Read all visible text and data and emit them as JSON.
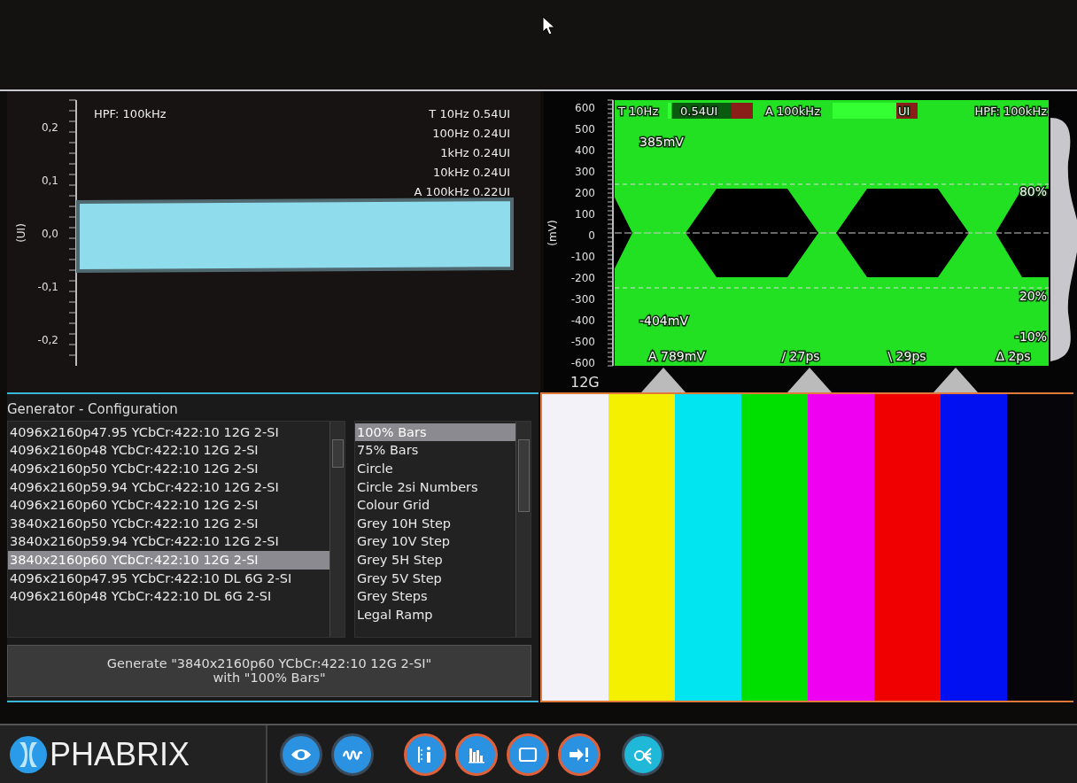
{
  "jitter_plot": {
    "y_axis_label": "(UI)",
    "y_ticks": [
      "0,2",
      "0,1",
      "0,0",
      "-0,1",
      "-0,2"
    ],
    "filter": "HPF: 100kHz",
    "readings": [
      "T 10Hz 0.54UI",
      "100Hz 0.24UI",
      "1kHz 0.24UI",
      "10kHz 0.24UI",
      "A 100kHz 0.22UI"
    ]
  },
  "eye_diagram": {
    "y_axis_label": "(mV)",
    "y_ticks": [
      "600",
      "500",
      "400",
      "300",
      "200",
      "100",
      "0",
      "-100",
      "-200",
      "-300",
      "-400",
      "-500",
      "-600"
    ],
    "rate": "12G",
    "filter": "HPF: 100kHz",
    "meters": [
      {
        "label": "T 10Hz",
        "value": "0.54UI",
        "level": 0.05
      },
      {
        "label": "A 100kHz",
        "value": "UI",
        "level": 0.85
      }
    ],
    "high_marker": "385mV",
    "low_marker": "-404mV",
    "thresholds": [
      "80%",
      "20%",
      "-10%"
    ],
    "measurements": [
      "A 789mV",
      "/ 27ps",
      "\\ 29ps",
      "Δ 2ps"
    ]
  },
  "generator": {
    "title": "Generator - Configuration",
    "formats": [
      {
        "label": "4096x2160p47.95 YCbCr:422:10 12G 2-SI",
        "selected": false
      },
      {
        "label": "4096x2160p48 YCbCr:422:10 12G 2-SI",
        "selected": false
      },
      {
        "label": "4096x2160p50 YCbCr:422:10 12G 2-SI",
        "selected": false
      },
      {
        "label": "4096x2160p59.94 YCbCr:422:10 12G 2-SI",
        "selected": false
      },
      {
        "label": "4096x2160p60 YCbCr:422:10 12G 2-SI",
        "selected": false
      },
      {
        "label": "3840x2160p50 YCbCr:422:10 12G 2-SI",
        "selected": false
      },
      {
        "label": "3840x2160p59.94 YCbCr:422:10 12G 2-SI",
        "selected": false
      },
      {
        "label": "3840x2160p60 YCbCr:422:10 12G 2-SI",
        "selected": true
      },
      {
        "label": "4096x2160p47.95 YCbCr:422:10 DL 6G 2-SI",
        "selected": false
      },
      {
        "label": "4096x2160p48 YCbCr:422:10 DL 6G 2-SI",
        "selected": false
      }
    ],
    "patterns": [
      {
        "label": "100% Bars",
        "selected": true
      },
      {
        "label": "75% Bars",
        "selected": false
      },
      {
        "label": "Circle",
        "selected": false
      },
      {
        "label": "Circle 2si Numbers",
        "selected": false
      },
      {
        "label": "Colour Grid",
        "selected": false
      },
      {
        "label": "Grey 10H Step",
        "selected": false
      },
      {
        "label": "Grey 10V Step",
        "selected": false
      },
      {
        "label": "Grey 5H Step",
        "selected": false
      },
      {
        "label": "Grey 5V Step",
        "selected": false
      },
      {
        "label": "Grey Steps",
        "selected": false
      },
      {
        "label": "Legal Ramp",
        "selected": false
      }
    ],
    "generate_button": "Generate \"3840x2160p60 YCbCr:422:10 12G 2-SI\"\nwith \"100% Bars\""
  },
  "color_bars": [
    {
      "color": "#f2f2f8"
    },
    {
      "color": "#f5f000"
    },
    {
      "color": "#00e5f0"
    },
    {
      "color": "#00e000"
    },
    {
      "color": "#f000f0"
    },
    {
      "color": "#f00000"
    },
    {
      "color": "#0010f0"
    },
    {
      "color": "#05050a"
    }
  ],
  "taskbar": {
    "brand": "PHABRIX",
    "buttons": [
      {
        "kind": "eye",
        "alert": false,
        "color": "#2a92e0"
      },
      {
        "kind": "wave",
        "alert": false,
        "color": "#2a92e0"
      },
      {
        "kind": "info-list",
        "alert": true,
        "color": "#2a92e0"
      },
      {
        "kind": "bars",
        "alert": true,
        "color": "#2a92e0"
      },
      {
        "kind": "monitor",
        "alert": true,
        "color": "#2a92e0"
      },
      {
        "kind": "arrow-alert",
        "alert": true,
        "color": "#2a92e0"
      },
      {
        "kind": "nodes",
        "alert": false,
        "color": "#1fb8d8"
      }
    ]
  }
}
